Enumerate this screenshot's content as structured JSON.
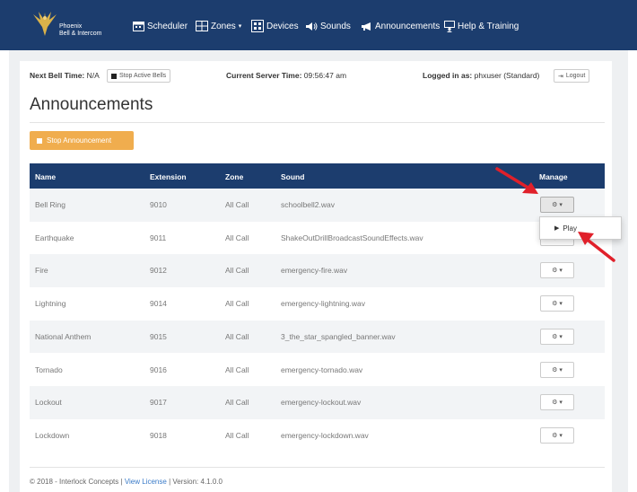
{
  "brand": {
    "line1": "Phoenix",
    "line2": "Bell & Intercom"
  },
  "nav": [
    {
      "label": "Scheduler",
      "icon": "calendar-icon"
    },
    {
      "label": "Zones",
      "icon": "zones-icon",
      "caret": true
    },
    {
      "label": "Devices",
      "icon": "devices-icon"
    },
    {
      "label": "Sounds",
      "icon": "speaker-icon"
    },
    {
      "label": "Announcements",
      "icon": "megaphone-icon"
    },
    {
      "label": "Help & Training",
      "icon": "help-icon"
    }
  ],
  "status": {
    "next_bell_label": "Next Bell Time:",
    "next_bell_value": "N/A",
    "stop_bells_label": "Stop Active Bells",
    "server_time_label": "Current Server Time:",
    "server_time_value": "09:56:47 am",
    "logged_in_label": "Logged in as:",
    "logged_in_value": "phxuser (Standard)",
    "logout_label": "Logout"
  },
  "page_title": "Announcements",
  "stop_announcement_label": "Stop Announcement",
  "table": {
    "headers": [
      "Name",
      "Extension",
      "Zone",
      "Sound",
      "Manage"
    ],
    "rows": [
      {
        "name": "Bell Ring",
        "extension": "9010",
        "zone": "All Call",
        "sound": "schoolbell2.wav"
      },
      {
        "name": "Earthquake",
        "extension": "9011",
        "zone": "All Call",
        "sound": "ShakeOutDrillBroadcastSoundEffects.wav"
      },
      {
        "name": "Fire",
        "extension": "9012",
        "zone": "All Call",
        "sound": "emergency-fire.wav"
      },
      {
        "name": "Lightning",
        "extension": "9014",
        "zone": "All Call",
        "sound": "emergency-lightning.wav"
      },
      {
        "name": "National Anthem",
        "extension": "9015",
        "zone": "All Call",
        "sound": "3_the_star_spangled_banner.wav"
      },
      {
        "name": "Tornado",
        "extension": "9016",
        "zone": "All Call",
        "sound": "emergency-tornado.wav"
      },
      {
        "name": "Lockout",
        "extension": "9017",
        "zone": "All Call",
        "sound": "emergency-lockout.wav"
      },
      {
        "name": "Lockdown",
        "extension": "9018",
        "zone": "All Call",
        "sound": "emergency-lockdown.wav"
      }
    ]
  },
  "dropdown": {
    "play_label": "Play"
  },
  "footer": {
    "copyright": "© 2018 - Interlock Concepts",
    "sep1": "|",
    "license_link": "View License",
    "sep2": "|",
    "version": "Version: 4.1.0.0"
  },
  "colors": {
    "navbar": "#1c3d6e",
    "warning": "#f0ad4e",
    "arrow": "#e0202a",
    "link": "#3a7bc8"
  }
}
